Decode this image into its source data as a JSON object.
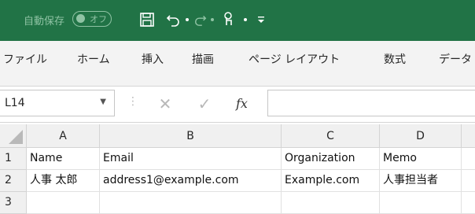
{
  "titlebar": {
    "autosave_label": "自動保存",
    "autosave_state": "オフ",
    "accent_color": "#217346"
  },
  "ribbon": {
    "tabs": [
      "ファイル",
      "ホーム",
      "挿入",
      "描画",
      "ページ レイアウト",
      "数式",
      "データ"
    ]
  },
  "formula_bar": {
    "name_box": "L14",
    "fx_label": "fx",
    "formula_value": ""
  },
  "sheet": {
    "columns": [
      "A",
      "B",
      "C",
      "D"
    ],
    "rows": [
      {
        "num": "1",
        "cells": [
          "Name",
          "Email",
          "Organization",
          "Memo"
        ]
      },
      {
        "num": "2",
        "cells": [
          "人事 太郎",
          "address1@example.com",
          "Example.com",
          "人事担当者"
        ]
      },
      {
        "num": "3",
        "cells": [
          "",
          "",
          "",
          ""
        ]
      }
    ]
  }
}
